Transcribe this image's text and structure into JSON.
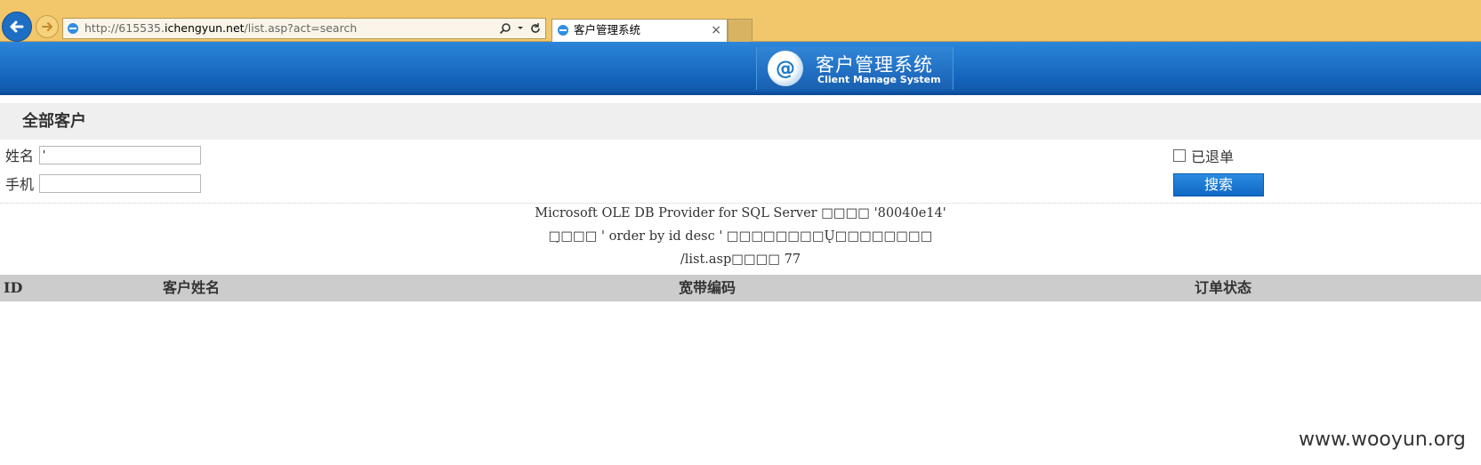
{
  "browser": {
    "url_prefix": "http://615535.",
    "url_host": "ichengyun.net",
    "url_path": "/list.asp?act=search",
    "tab_title": "客户管理系统",
    "tab_close": "×"
  },
  "header": {
    "title_cn": "客户管理系统",
    "title_en": "Client Manage System"
  },
  "section": {
    "title": "全部客户"
  },
  "search_form": {
    "name_label": "姓名",
    "name_value": "'",
    "phone_label": "手机",
    "phone_value": "",
    "checkbox_label": "已退单",
    "checkbox_checked": false,
    "search_button": "搜索"
  },
  "error": {
    "line1": "Microsoft OLE DB Provider for SQL Server □□□□ '80040e14'",
    "line2": "□̦□□□ ' order by id desc ' □□□□□□□□Ų□□□□□□□□",
    "line3": "/list.asp□□□□ 77"
  },
  "table": {
    "columns": [
      "ID",
      "客户姓名",
      "宽带编码",
      "订单状态"
    ]
  },
  "watermark": "www.wooyun.org"
}
